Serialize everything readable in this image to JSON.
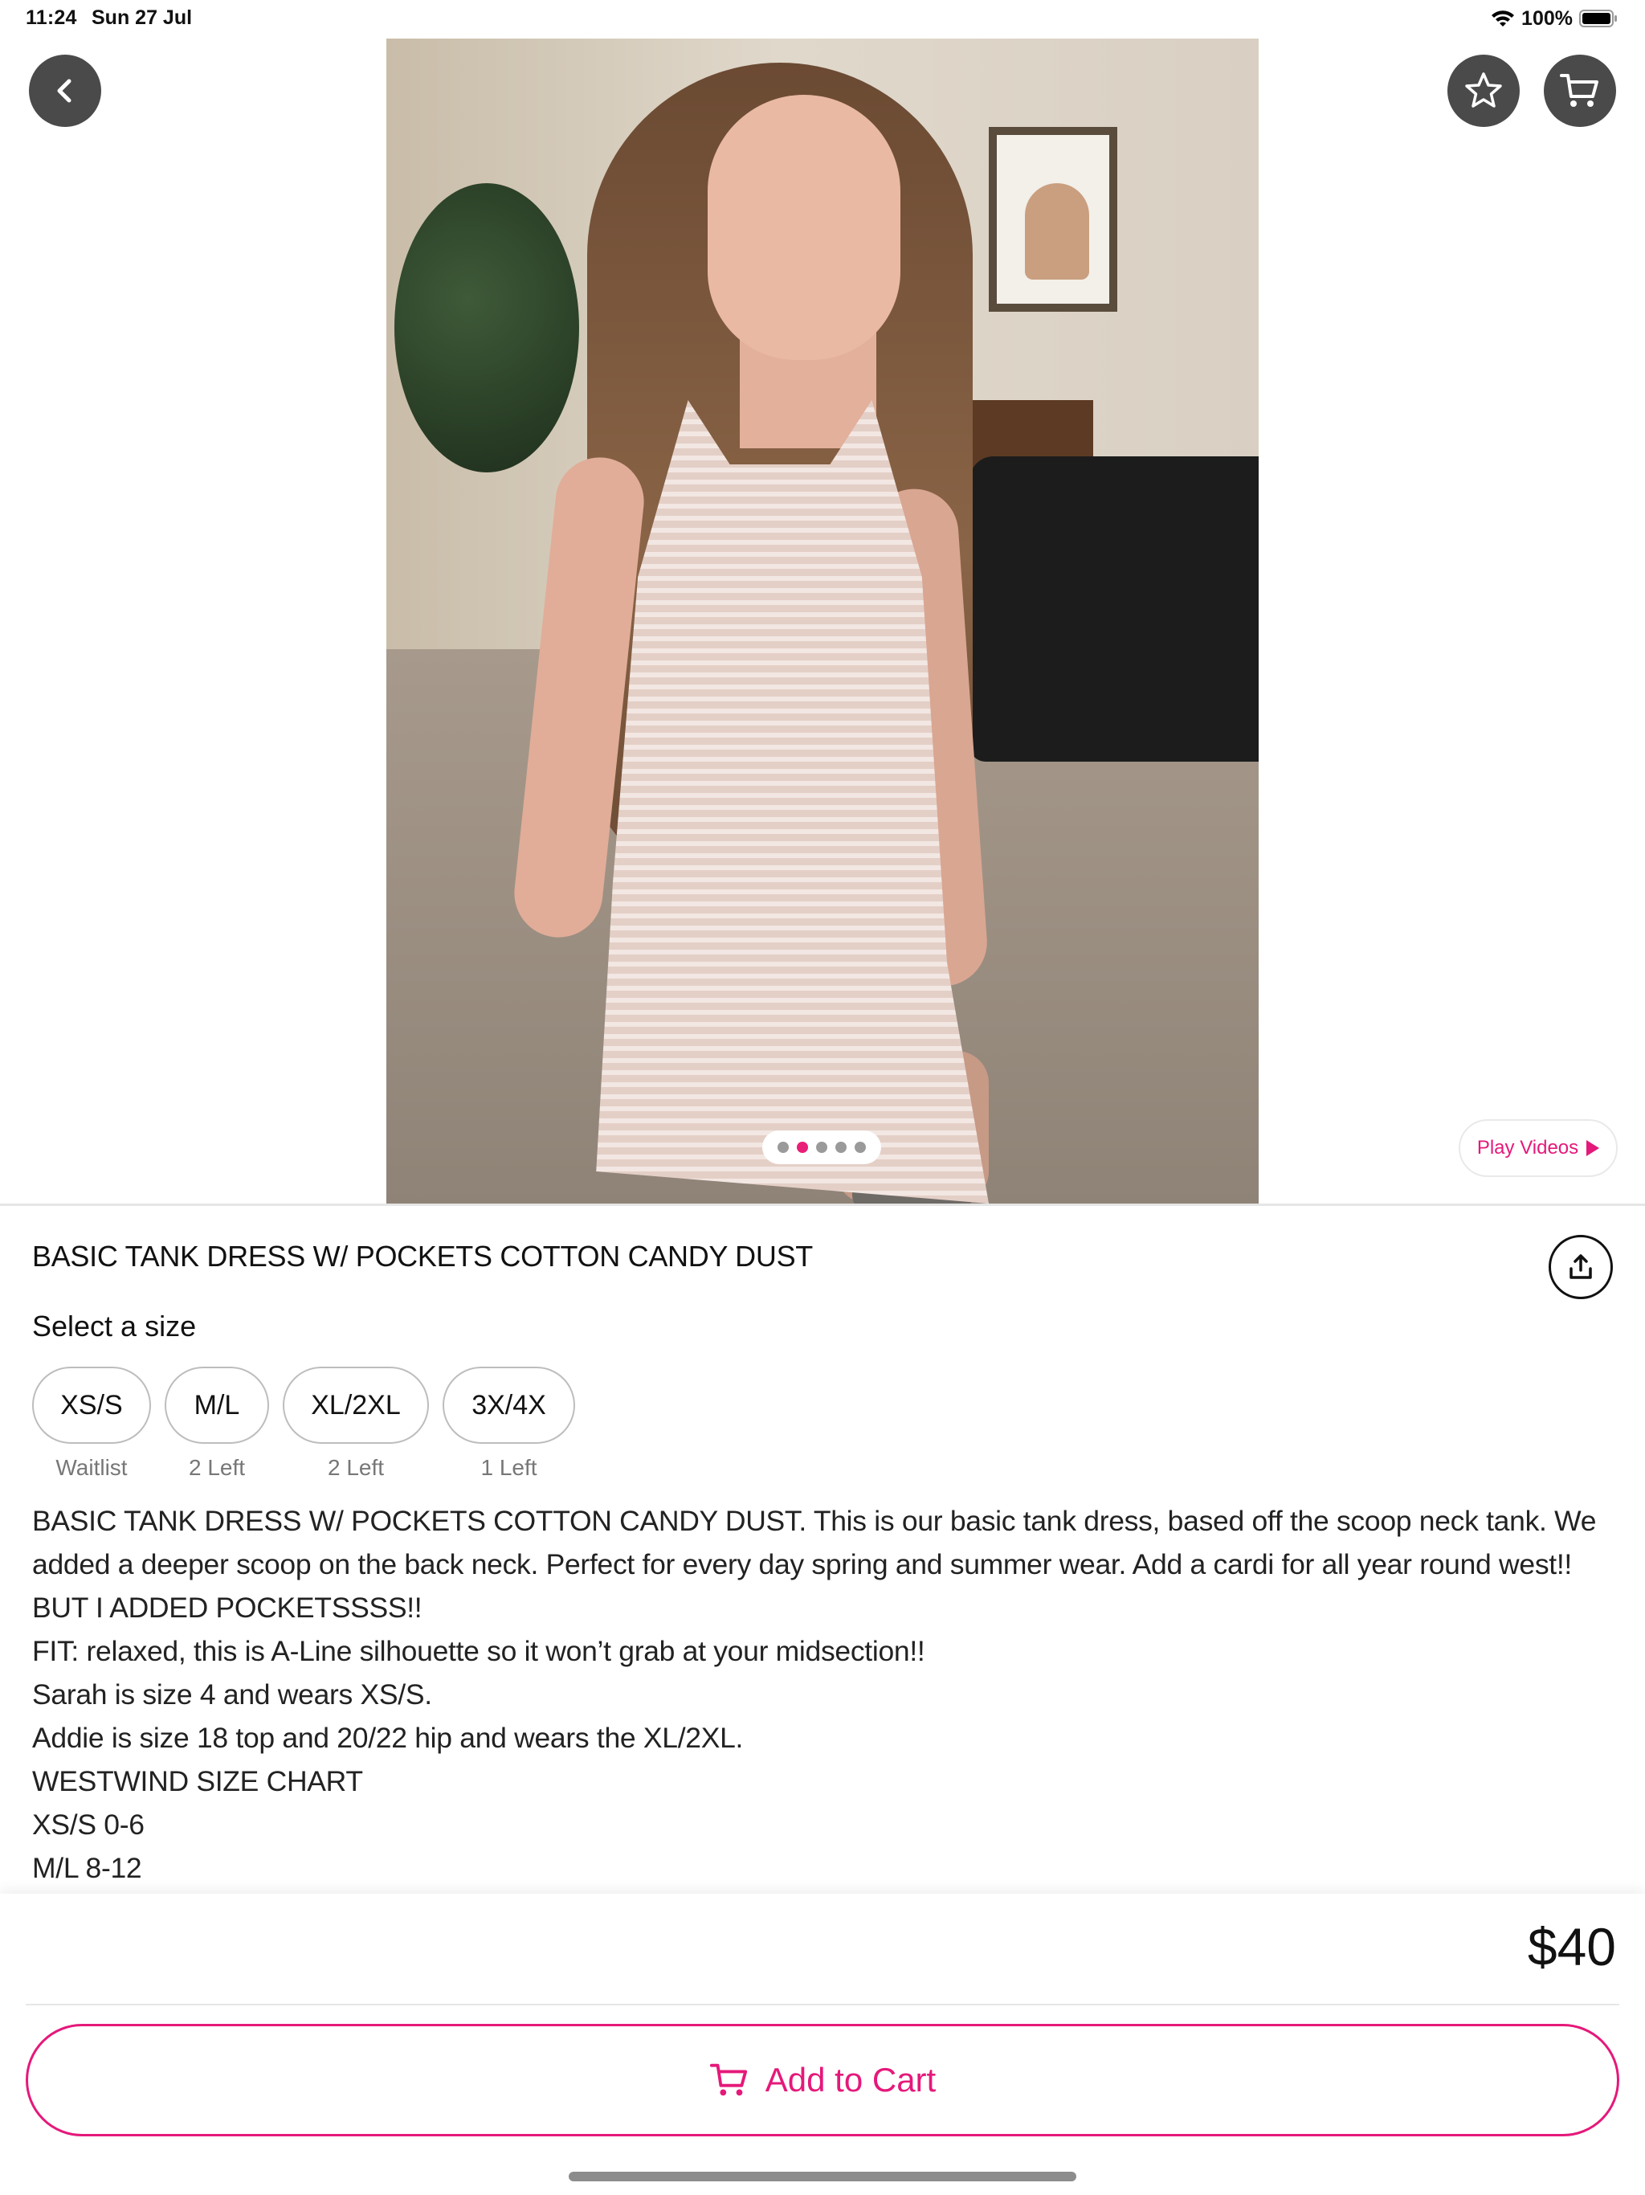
{
  "status_bar": {
    "time": "11:24",
    "date": "Sun 27 Jul",
    "battery": "100%"
  },
  "icons": {
    "back": "chevron-left-icon",
    "favorite": "star-icon",
    "cart": "cart-icon",
    "share": "share-icon",
    "play": "play-icon"
  },
  "hero": {
    "pagination": {
      "total": 5,
      "active_index": 1
    },
    "play_videos_label": "Play Videos"
  },
  "product": {
    "title": "BASIC TANK DRESS W/ POCKETS COTTON CANDY DUST",
    "select_size_label": "Select a size",
    "sizes": [
      {
        "label": "XS/S",
        "stock": "Waitlist"
      },
      {
        "label": "M/L",
        "stock": "2 Left"
      },
      {
        "label": "XL/2XL",
        "stock": "2 Left"
      },
      {
        "label": "3X/4X",
        "stock": "1 Left"
      }
    ],
    "description": [
      "BASIC TANK DRESS W/ POCKETS COTTON CANDY DUST. This is our basic tank dress, based off the scoop neck tank. We added a deeper scoop on the back neck. Perfect for every day spring and summer wear. Add a cardi for all year round west!! BUT I ADDED POCKETSSSS!!",
      "FIT: relaxed, this is A-Line silhouette so it won’t grab at your midsection!!",
      "Sarah is size 4 and wears XS/S.",
      "Addie is size 18 top and 20/22 hip and wears the XL/2XL.",
      "WESTWIND SIZE CHART",
      "XS/S 0-6",
      "M/L 8-12"
    ],
    "price": "$40",
    "add_to_cart_label": "Add to Cart"
  },
  "colors": {
    "accent": "#e5197a",
    "button_dark": "#4a4a4a"
  }
}
